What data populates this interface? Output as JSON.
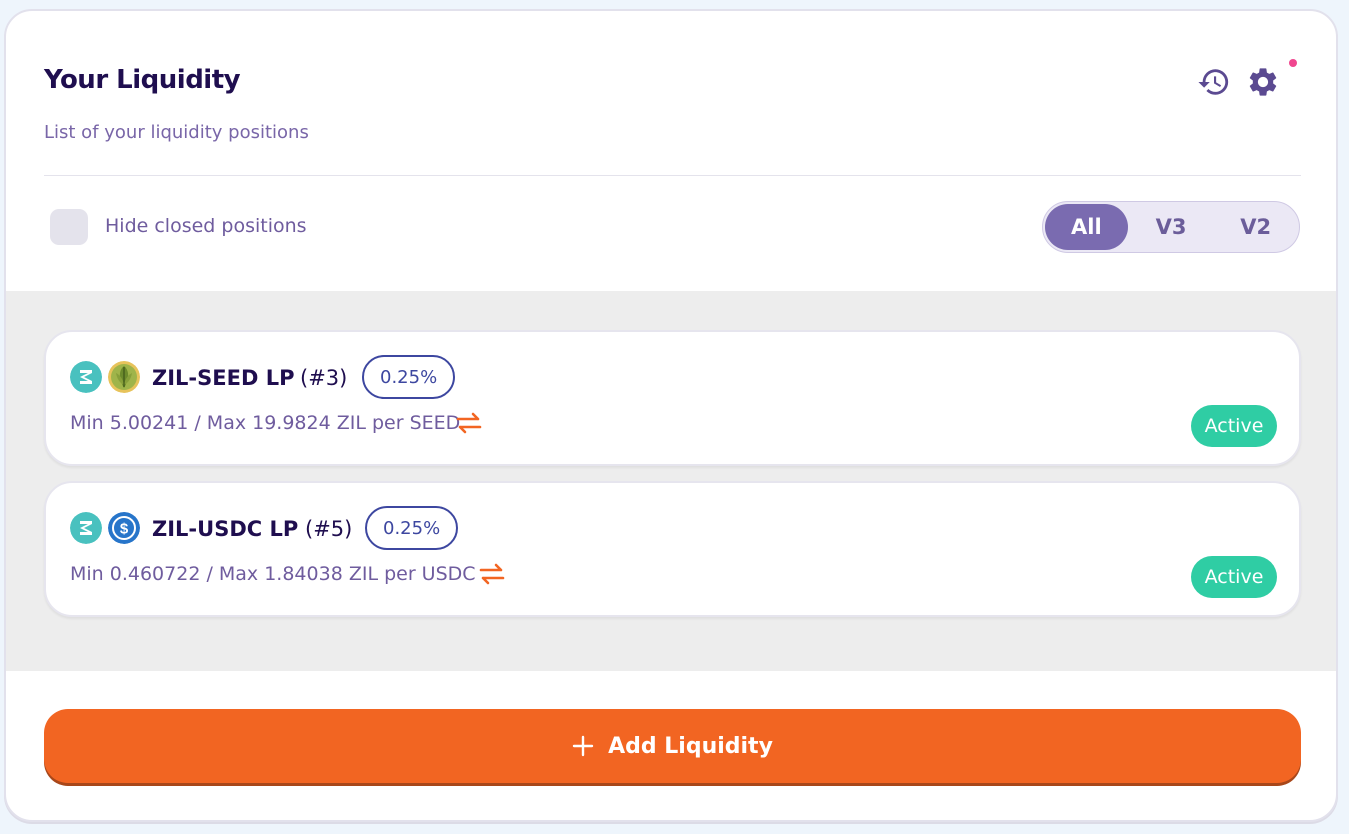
{
  "header": {
    "title": "Your Liquidity",
    "subtitle": "List of your liquidity positions"
  },
  "filters": {
    "hide_closed_label": "Hide closed positions",
    "hide_closed_checked": false,
    "versions": [
      "All",
      "V3",
      "V2"
    ],
    "selected_version": "All"
  },
  "positions": [
    {
      "pair": "ZIL-SEED LP",
      "id": "(#3)",
      "fee": "0.25%",
      "range": "Min 5.00241 / Max 19.9824 ZIL per SEED",
      "status": "Active",
      "token_icons": [
        "zil-token-icon",
        "seed-token-icon"
      ]
    },
    {
      "pair": "ZIL-USDC LP",
      "id": "(#5)",
      "fee": "0.25%",
      "range": "Min 0.460722 / Max 1.84038 ZIL per USDC",
      "status": "Active",
      "token_icons": [
        "zil-token-icon",
        "usdc-token-icon"
      ]
    }
  ],
  "actions": {
    "add_liquidity": "Add Liquidity"
  },
  "colors": {
    "title": "#1f0e4f",
    "muted": "#7966a8",
    "accent": "#f26522",
    "active": "#2fcda4",
    "badge_border": "#3d47a0",
    "segment_active": "#7a6bb0"
  }
}
